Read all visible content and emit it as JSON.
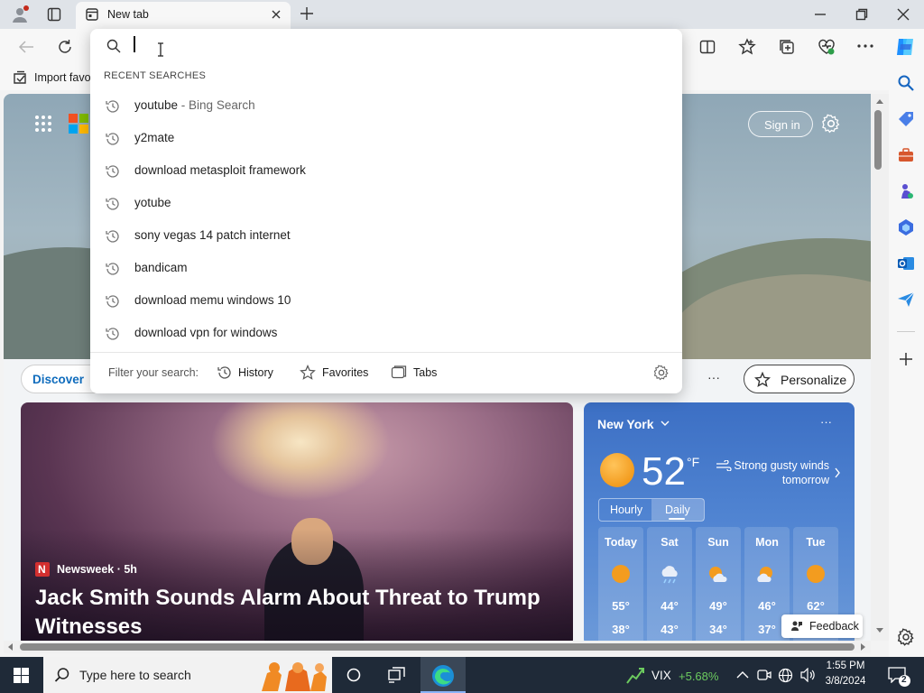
{
  "browser": {
    "tab_title": "New tab",
    "favorites_bar_import": "Import favo",
    "address_value": ""
  },
  "dropdown": {
    "section_title": "RECENT SEARCHES",
    "items": [
      {
        "text": "youtube",
        "sub": " - Bing Search"
      },
      {
        "text": "y2mate",
        "sub": ""
      },
      {
        "text": "download metasploit framework",
        "sub": ""
      },
      {
        "text": "yotube",
        "sub": ""
      },
      {
        "text": "sony vegas 14 patch internet",
        "sub": ""
      },
      {
        "text": "bandicam",
        "sub": ""
      },
      {
        "text": "download memu windows 10",
        "sub": ""
      },
      {
        "text": "download vpn for windows",
        "sub": ""
      }
    ],
    "filter_label": "Filter your search:",
    "filters": [
      "History",
      "Favorites",
      "Tabs"
    ]
  },
  "newtab": {
    "sign_in": "Sign in",
    "discover": "Discover",
    "personalize": "Personalize",
    "more": "···"
  },
  "news": {
    "source": "Newsweek · 5h",
    "source_logo": "N",
    "headline": "Jack Smith Sounds Alarm About Threat to Trump Witnesses"
  },
  "weather": {
    "location": "New York",
    "temp": "52",
    "unit": "°F",
    "alert": "Strong gusty winds tomorrow",
    "tabs": [
      "Hourly",
      "Daily"
    ],
    "active_tab": "Daily",
    "days": [
      {
        "day": "Today",
        "hi": "55°",
        "lo": "38°",
        "icon": "sun-icon"
      },
      {
        "day": "Sat",
        "hi": "44°",
        "lo": "43°",
        "icon": "rain-cloud-icon"
      },
      {
        "day": "Sun",
        "hi": "49°",
        "lo": "34°",
        "icon": "partly-cloudy-icon"
      },
      {
        "day": "Mon",
        "hi": "46°",
        "lo": "37°",
        "icon": "partly-cloudy-icon"
      },
      {
        "day": "Tue",
        "hi": "62°",
        "lo": "",
        "icon": "sun-icon"
      }
    ],
    "feedback": "Feedback"
  },
  "taskbar": {
    "search_placeholder": "Type here to search",
    "stock_name": "VIX",
    "stock_change": "+5.68%",
    "time": "1:55 PM",
    "date": "3/8/2024",
    "notification_count": "2"
  },
  "colors": {
    "accent": "#0f6cbd",
    "taskbar": "#1f2a38",
    "stock_up": "#6ccb5f",
    "weather_bg": "#3c6fc4",
    "sun": "#f39c1f"
  }
}
